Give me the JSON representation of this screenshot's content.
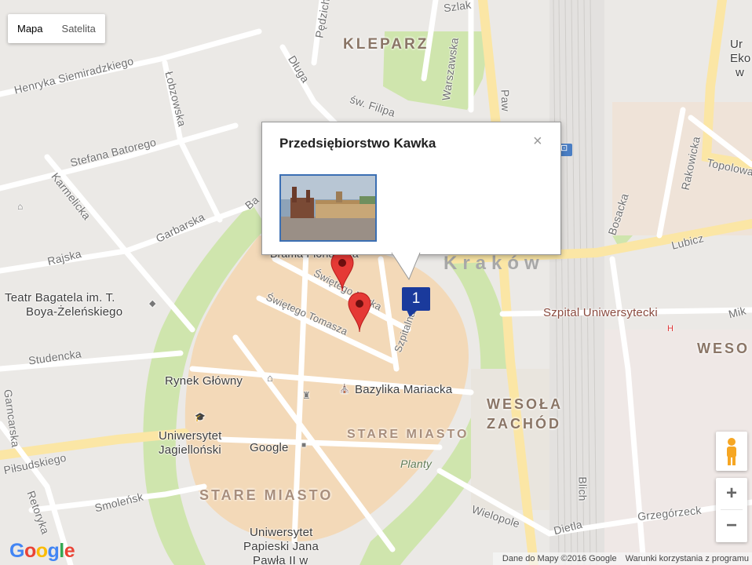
{
  "map_type": {
    "map": "Mapa",
    "satellite": "Satelita",
    "selected": "Mapa"
  },
  "popup": {
    "title": "Przedsiębiorstwo Kawka",
    "close": "×"
  },
  "cluster": {
    "count": "1",
    "color": "#1a3a9c"
  },
  "colors": {
    "marker": "#e53935",
    "park": "#cfe5ad",
    "old_town": "#f3d9b8"
  },
  "labels": {
    "kleparz": "KLEPARZ",
    "krakow": "Kraków",
    "stare_miasto_1": "STARE MIASTO",
    "stare_miasto_2": "STARE MIASTO",
    "wesola_1": "WESOŁA",
    "wesola_2": "ZACHÓD",
    "wesola_edge": "WESO",
    "planty": "Planty",
    "rynek": "Rynek Główny",
    "bazylika": "Bazylika Mariacka",
    "uniwersytet": "Uniwersytet",
    "uniwersytet2": "Jagielloński",
    "papieski1": "Uniwersytet",
    "papieski2": "Papieski Jana",
    "papieski3": "Pawła II w",
    "google_poi": "Google",
    "szpital": "Szpital Uniwersytecki",
    "szpital_h": "H",
    "teatr1": "Teatr Bagatela im. T.",
    "teatr2": "Boya-Żeleńskiego",
    "brama": "Brama Floriańska",
    "top_right": "Ur",
    "top_right2": "Eko",
    "top_right3": "w"
  },
  "streets": {
    "szlak": "Szlak",
    "pedzich": "Pędzich",
    "warszawska": "Warszawska",
    "dluga": "Długa",
    "sw_filipa": "św. Filipa",
    "pawia": "Paw",
    "henryka": "Henryka Siemiradzkiego",
    "lobzowska": "Łobzowska",
    "batorego": "Stefana Batorego",
    "karmelicka": "Karmelicka",
    "garbarska": "Garbarska",
    "basztowa": "Ba",
    "rajska": "Rajska",
    "swietego_marka": "Świętego Marka",
    "swietego_tomasza": "Świętego Tomasza",
    "szpitalna": "Szpitalna",
    "studencka": "Studencka",
    "garncarska": "Garncarska",
    "pilsudskiego": "Piłsudskiego",
    "retoryka": "Retoryka",
    "smolensk": "Smoleńsk",
    "lubicz": "Lubicz",
    "bosacka": "Bosacka",
    "rakowicka": "Rakowicka",
    "topolowa": "Topolowa",
    "mikolaj": "Mik",
    "wielopole": "Wielopole",
    "dietla": "Dietla",
    "blich": "Blich",
    "grzegorzecka": "Grzegórzeck"
  },
  "controls": {
    "zoom_in": "+",
    "zoom_out": "−",
    "pegman": "pegman-icon"
  },
  "footer": {
    "data": "Dane do Mapy ©2016 Google",
    "terms": "Warunki korzystania z programu"
  },
  "logo": {
    "G1": "G",
    "o1": "o",
    "o2": "o",
    "g": "g",
    "l": "l",
    "e": "e"
  }
}
